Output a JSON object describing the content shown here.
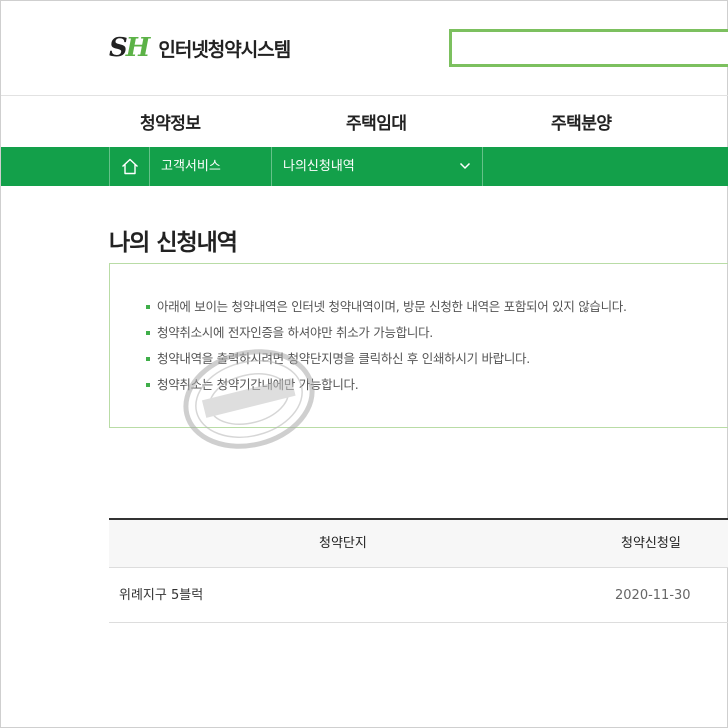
{
  "header": {
    "logo_mark_s": "S",
    "logo_mark_h": "H",
    "logo_text": "인터넷청약시스템",
    "search_value": ""
  },
  "gnb": {
    "items": [
      {
        "label": "청약정보"
      },
      {
        "label": "주택임대"
      },
      {
        "label": "주택분양"
      }
    ]
  },
  "location": {
    "home_icon": "home-icon",
    "level1": "고객서비스",
    "level2": "나의신청내역",
    "dropdown_icon": "chevron-down-icon"
  },
  "page": {
    "title": "나의 신청내역"
  },
  "notice": {
    "items": [
      "아래에 보이는 청약내역은 인터넷 청약내역이며, 방문 신청한 내역은 포함되어 있지 않습니다.",
      "청약취소시에 전자인증을 하셔야만 취소가 가능합니다.",
      "청약내역을 출력하시려면 청약단지명을 클릭하신 후 인쇄하시기 바랍니다.",
      "청약취소는 청약기간내에만 가능합니다."
    ]
  },
  "table": {
    "headers": [
      "청약단지",
      "청약신청일"
    ],
    "rows": [
      {
        "complex": "위례지구 5블럭",
        "date": "2020-11-30"
      }
    ]
  },
  "colors": {
    "brand_green": "#13a04a",
    "logo_green": "#5cb247",
    "search_border": "#7cc05f",
    "notice_border": "#b9dca6",
    "bullet": "#3fae49"
  }
}
